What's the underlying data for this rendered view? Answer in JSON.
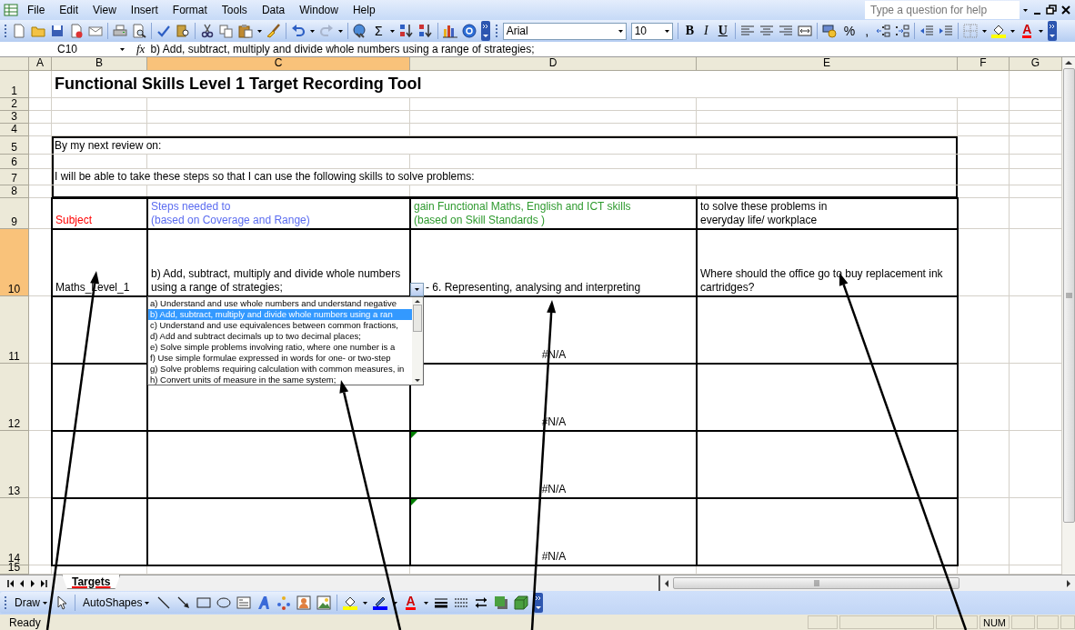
{
  "menu_bar": {
    "items": [
      "File",
      "Edit",
      "View",
      "Insert",
      "Format",
      "Tools",
      "Data",
      "Window",
      "Help"
    ],
    "help_box": {
      "placeholder": "Type a question for help"
    }
  },
  "standard_toolbar": {
    "sum_symbol": "Σ"
  },
  "formatting_toolbar": {
    "font": "Arial",
    "font_size": "10",
    "style_buttons": [
      {
        "label": "B",
        "kind": "bold"
      },
      {
        "label": "I",
        "kind": "italic"
      },
      {
        "label": "U",
        "kind": "underline"
      }
    ],
    "number_buttons": [
      "%",
      ","
    ],
    "font_color_label": "A"
  },
  "formula_bar": {
    "name_box": "C10",
    "function_label": "fx",
    "value": "b) Add, subtract, multiply and divide whole numbers using a range of strategies;"
  },
  "sheet": {
    "columns": [
      {
        "label": "A",
        "selected": false
      },
      {
        "label": "B",
        "selected": false
      },
      {
        "label": "C",
        "selected": true
      },
      {
        "label": "D",
        "selected": false
      },
      {
        "label": "E",
        "selected": false
      },
      {
        "label": "F",
        "selected": false
      },
      {
        "label": "G",
        "selected": false
      }
    ],
    "rows": [
      {
        "label": "1",
        "selected": false,
        "cells": {
          "B": {
            "kind": "title",
            "text": "Functional Skills Level 1 Target Recording Tool"
          }
        }
      },
      {
        "label": "2",
        "selected": false,
        "cells": {}
      },
      {
        "label": "3",
        "selected": false,
        "cells": {}
      },
      {
        "label": "4",
        "selected": false,
        "cells": {}
      },
      {
        "label": "5",
        "selected": false,
        "cells": {
          "B": {
            "kind": "note",
            "text": "By my next review on:"
          }
        }
      },
      {
        "label": "6",
        "selected": false,
        "cells": {}
      },
      {
        "label": "7",
        "selected": false,
        "cells": {
          "B": {
            "kind": "note",
            "text": "I will be able to take these steps so that I can use the following skills to solve problems:"
          }
        }
      },
      {
        "label": "8",
        "selected": false,
        "cells": {}
      },
      {
        "label": "9",
        "selected": false,
        "cells": {
          "B": {
            "kind": "text",
            "text": "Subject",
            "color": "#ff0000"
          },
          "C": {
            "kind": "text",
            "text": "Steps needed to\n(based on Coverage and Range)",
            "color": "#5b6cf0"
          },
          "D": {
            "kind": "text",
            "text": "gain Functional Maths, English and ICT skills\n(based on Skill Standards )",
            "color": "#2e9a2e"
          },
          "E": {
            "kind": "text",
            "text": "to solve these problems in\neveryday life/ workplace"
          }
        }
      },
      {
        "label": "10",
        "selected": true,
        "cells": {
          "B": {
            "kind": "text",
            "text": "Maths_Level_1"
          },
          "C": {
            "kind": "text",
            "text": "b) Add, subtract, multiply and divide whole numbers using a range of strategies;"
          },
          "D": {
            "kind": "text",
            "text": "- 6. Representing, analysing and interpreting"
          },
          "E": {
            "kind": "text",
            "text": "Where should the office go to buy replacement ink cartridges?"
          }
        }
      },
      {
        "label": "11",
        "selected": false,
        "cells": {
          "D": {
            "kind": "error",
            "text": "#N/A"
          }
        }
      },
      {
        "label": "12",
        "selected": false,
        "cells": {
          "D": {
            "kind": "error",
            "text": "#N/A"
          }
        }
      },
      {
        "label": "13",
        "selected": false,
        "cells": {
          "D": {
            "kind": "error",
            "text": "#N/A",
            "flagged": true
          }
        }
      },
      {
        "label": "14",
        "selected": false,
        "cells": {
          "D": {
            "kind": "error",
            "text": "#N/A",
            "flagged": true
          }
        }
      },
      {
        "label": "15",
        "selected": false,
        "cells": {}
      }
    ]
  },
  "dropdown": {
    "items": [
      {
        "text": "a) Understand and use whole numbers and understand negative",
        "selected": false
      },
      {
        "text": "b) Add, subtract, multiply and divide whole numbers using a ran",
        "selected": true
      },
      {
        "text": "c) Understand and use equivalences between common fractions,",
        "selected": false
      },
      {
        "text": "d) Add and subtract decimals up to two decimal places;",
        "selected": false
      },
      {
        "text": "e) Solve simple problems involving ratio, where one number is a",
        "selected": false
      },
      {
        "text": "f) Use simple formulae expressed in words for one- or two-step",
        "selected": false
      },
      {
        "text": "g) Solve problems requiring calculation with common measures, in",
        "selected": false
      },
      {
        "text": "h) Convert units of measure in the same system;",
        "selected": false
      }
    ]
  },
  "sheet_tabs": [
    {
      "label": "Targets",
      "selected": true
    }
  ],
  "drawing_toolbar": {
    "draw_label": "Draw",
    "autoshapes_label": "AutoShapes",
    "font_color_label": "A"
  },
  "status_bar": {
    "text": "Ready",
    "indicators": [
      "NUM"
    ]
  }
}
